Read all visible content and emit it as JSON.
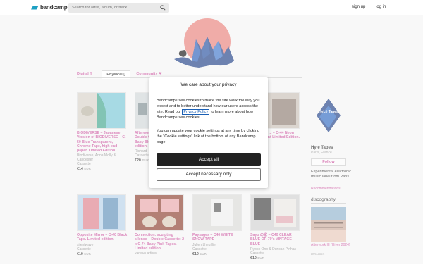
{
  "header": {
    "logo_text": "bandcamp",
    "search_placeholder": "Search for artist, album, or track",
    "signup": "sign up",
    "login": "log in"
  },
  "tabs": [
    {
      "label": "Digital ▯"
    },
    {
      "label": "Physical ▯"
    },
    {
      "label": "Community ❤"
    }
  ],
  "items": [
    {
      "title": "BIODIVERSE – Japanese Version of BIODIVERSE – C-50 Blue Transparent, Chrome Tape, high end paper. Limited Edition.",
      "artist": "Biodiverse, Anna Molly & Candester",
      "format": "Cassette",
      "price": "€14",
      "currency": "EUR"
    },
    {
      "title": "Afterwork III (Hiver 2024) – Double Cassette – 2 x C-74 Baby Blue Tapes. Limited edition.",
      "artist": "Richard",
      "format": "Cassette",
      "price": "€20",
      "currency": "EUR"
    },
    {
      "title": "Opposite Mirror – C-40 Black Tape. Limited edition.",
      "artist": "silentwave",
      "format": "Cassette",
      "price": "€10",
      "currency": "EUR"
    },
    {
      "title": "Connection: sculpting silence – Double Cassette: 2 x C-74 Baby Pink Tapes. Limited edition.",
      "artist": "various artists",
      "format": "Cassette",
      "price": "",
      "currency": ""
    },
    {
      "title": "Paysages – C40 WHITE SNOW TAPE",
      "artist": "Julien Lheuillier",
      "format": "Cassette",
      "price": "€10",
      "currency": "EUR"
    },
    {
      "title": "Sayo の家 – C40 CLEAR BLUE OR 70's VINTAGE BLUE",
      "artist": "Ryoko Ono & Duncan Pinhas",
      "format": "Cassette",
      "price": "€10",
      "currency": "EUR"
    },
    {
      "title": "...rk (Todo ... – C-44 Neon Transparent Limited Edition.",
      "artist": "Tapes",
      "format": "",
      "price": "",
      "currency": ""
    }
  ],
  "sidebar": {
    "label_name": "Hylé Tapes",
    "location": "Paris, France",
    "follow": "Follow",
    "description": "Experimental electronic music label from Paris.",
    "recommendations": "Recommendations",
    "discography": "discography",
    "disc_title": "Afterwork III (Hiver 2024)",
    "disc_date": "Dec 2024",
    "avatar_text": "HyLé Tapes"
  },
  "modal": {
    "title": "We care about your privacy",
    "p1_before": "Bandcamp uses cookies to make the site work the way you expect and to better understand how our users access the site. Read our ",
    "p1_link": "Privacy Policy",
    "p1_after": " to learn more about how Bandcamp uses cookies.",
    "p2": "You can update your cookie settings at any time by clicking the “Cookie settings” link at the bottom of any Bandcamp page.",
    "accept_all": "Accept all",
    "accept_necessary": "Accept necessary only"
  },
  "colors": {
    "accent": "#c94b9a",
    "brand": "#1da0c3",
    "dark_button": "#222222"
  }
}
